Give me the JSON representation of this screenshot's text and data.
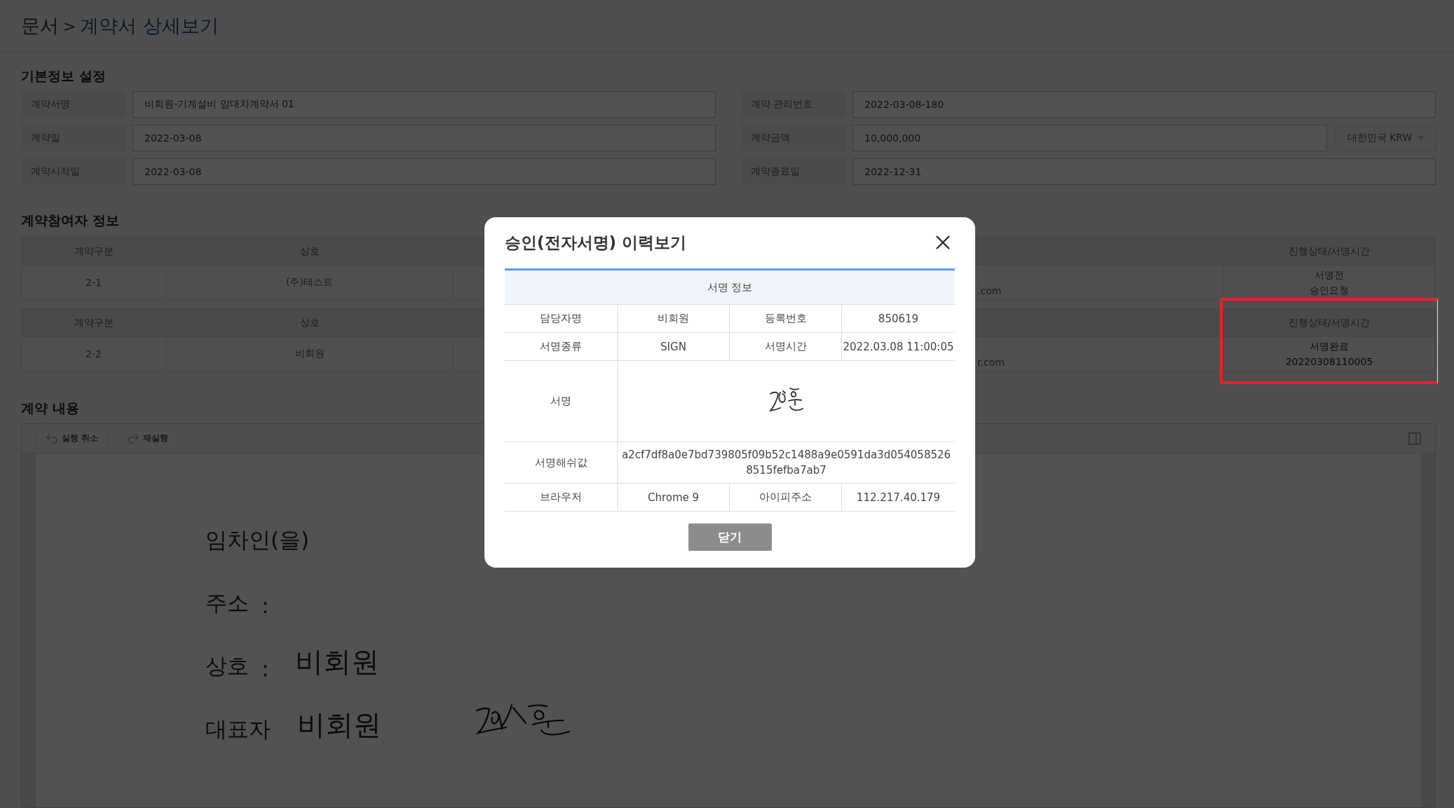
{
  "breadcrumb": {
    "parent": "문서",
    "separator": ">",
    "current": "계약서 상세보기"
  },
  "basic_info": {
    "title": "기본정보 설정",
    "left": [
      {
        "label": "계약서명",
        "value": "비회원-기계설비 임대차계약서 01"
      },
      {
        "label": "계약일",
        "value": "2022-03-08"
      },
      {
        "label": "계약시작일",
        "value": "2022-03-08"
      }
    ],
    "right": [
      {
        "label": "계약 관리번호",
        "value": "2022-03-08-180"
      },
      {
        "label": "계약금액",
        "value": "10,000,000",
        "currency": "대한민국 KRW"
      },
      {
        "label": "계약종료일",
        "value": "2022-12-31"
      }
    ]
  },
  "participants": {
    "title": "계약참여자 정보",
    "tables": [
      {
        "highlighted": false,
        "columns": [
          "계약구분",
          "상호",
          "진행상태/서명시간"
        ],
        "cells": [
          "2-1",
          "(주)테스트",
          ".com"
        ],
        "status": [
          "서명전",
          "승인요청"
        ]
      },
      {
        "highlighted": true,
        "columns": [
          "계약구분",
          "상호",
          "진행상태/서명시간"
        ],
        "cells": [
          "2-2",
          "비회원",
          "r.com"
        ],
        "status": [
          "서명완료",
          "20220308110005"
        ]
      }
    ]
  },
  "contract_content": {
    "title": "계약 내용",
    "toolbar": [
      {
        "kind": "undo",
        "label": "실행 취소"
      },
      {
        "kind": "redo",
        "label": "재실행"
      }
    ],
    "document": [
      {
        "label": "임차인(을)"
      },
      {
        "label": "주소",
        "separator": ":"
      },
      {
        "label": "상호",
        "separator": ":",
        "value": "비회원"
      },
      {
        "label": "대표자",
        "value": "비회원",
        "signed": true
      }
    ]
  },
  "modal": {
    "title": "승인(전자서명) 이력보기",
    "section": "서명 정보",
    "rows": [
      {
        "kind": "pair",
        "cells": [
          "담당자명",
          "비회원",
          "등록번호",
          "850619"
        ]
      },
      {
        "kind": "pair",
        "cells": [
          "서명종류",
          "SIGN",
          "서명시간",
          "2022.03.08 11:00:05"
        ]
      },
      {
        "kind": "signature",
        "label": "서명"
      },
      {
        "kind": "text",
        "label": "서명해쉬값",
        "value": "a2cf7df8a0e7bd739805f09b52c1488a9e0591da3d0540585268515fefba7ab7"
      },
      {
        "kind": "pair",
        "cells": [
          "브라우저",
          "Chrome 9",
          "아이피주소",
          "112.217.40.179"
        ]
      }
    ],
    "close_button": "닫기"
  }
}
